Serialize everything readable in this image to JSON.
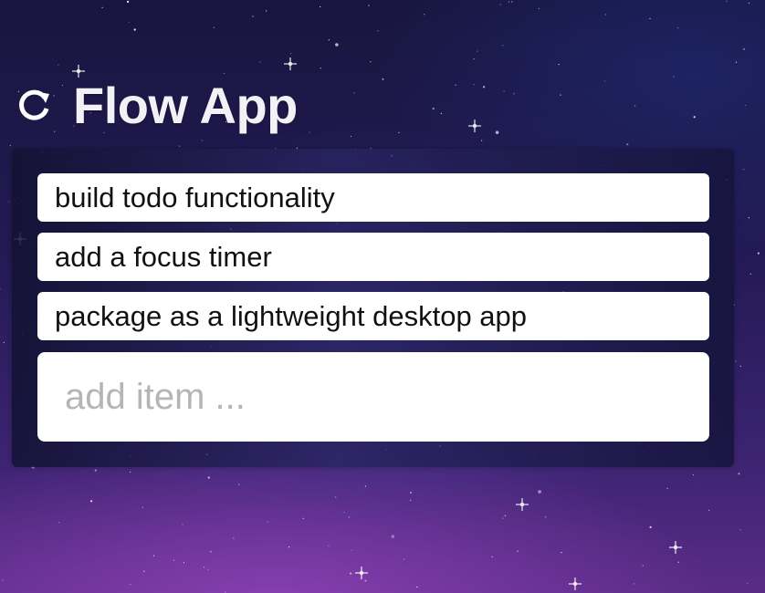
{
  "app": {
    "title": "Flow App",
    "logo_icon": "refresh-circle-icon"
  },
  "todos": [
    {
      "text": "build todo functionality"
    },
    {
      "text": "add a focus timer"
    },
    {
      "text": "package as a lightweight desktop app"
    }
  ],
  "add_item": {
    "placeholder": "add item ...",
    "value": ""
  },
  "colors": {
    "title": "#f2f2f6",
    "item_background": "#ffffff",
    "item_text": "#111111",
    "placeholder": "#b5b5b5",
    "panel": "#1c1a48"
  }
}
